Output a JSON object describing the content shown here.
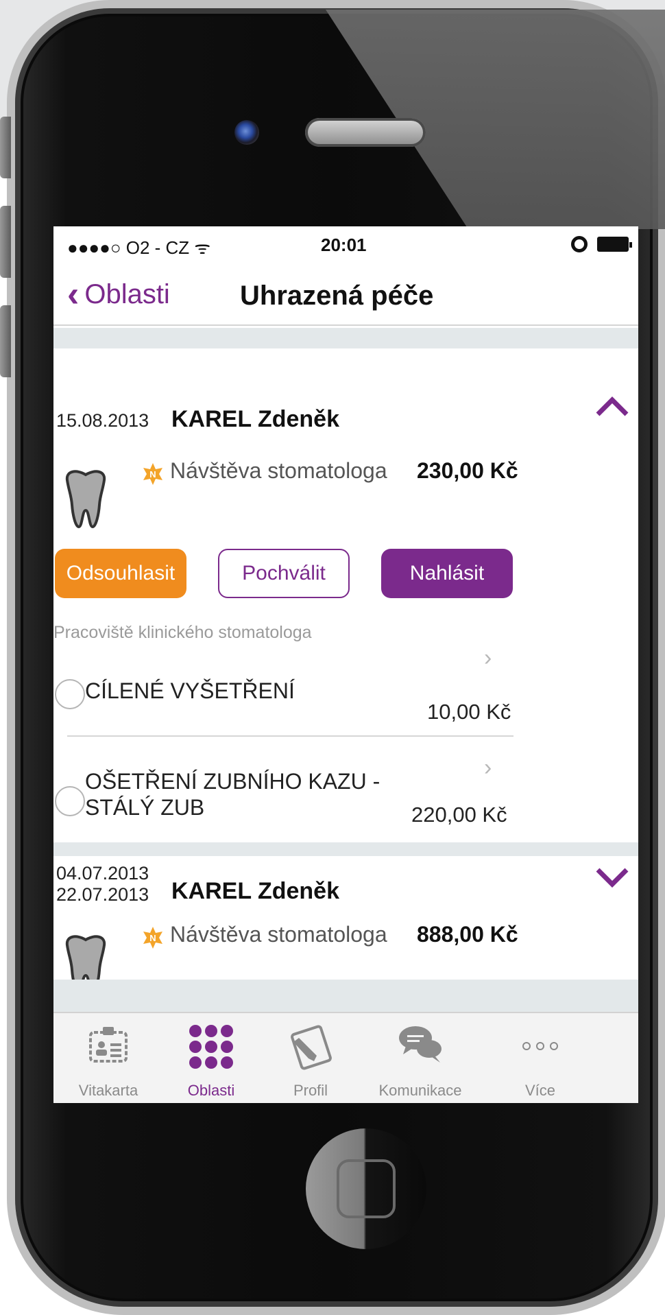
{
  "status_bar": {
    "carrier": "●●●●○ O2 - CZ ᯤ",
    "time": "20:01"
  },
  "nav": {
    "back_label": "Oblasti",
    "title": "Uhrazená péče"
  },
  "cards": [
    {
      "date": "15.08.2013",
      "name": "KAREL Zdeněk",
      "visit_type": "Návštěva stomatologa",
      "amount": "230,00 Kč",
      "expanded": true
    },
    {
      "date": "04.07.2013",
      "date_end": "22.07.2013",
      "name": "KAREL Zdeněk",
      "visit_type": "Návštěva stomatologa",
      "amount": "888,00 Kč",
      "expanded": false
    }
  ],
  "actions": {
    "reject": "Odsouhlasit",
    "praise": "Pochválit",
    "report": "Nahlásit"
  },
  "section_label": "Pracoviště klinického stomatologa",
  "items": [
    {
      "name": "CÍLENÉ VYŠETŘENÍ",
      "amount": "10,00 Kč"
    },
    {
      "name_line1": "OŠETŘENÍ ZUBNÍHO KAZU -",
      "name_line2": "STÁLÝ ZUB",
      "amount": "220,00 Kč"
    }
  ],
  "tabs": [
    {
      "label": "Vitakarta",
      "icon": "id-card-icon"
    },
    {
      "label": "Oblasti",
      "icon": "grid-dots-icon",
      "active": true
    },
    {
      "label": "Profil",
      "icon": "pencil-doc-icon"
    },
    {
      "label": "Komunikace",
      "icon": "chat-bubbles-icon"
    },
    {
      "label": "Více",
      "icon": "more-dots-icon"
    }
  ],
  "colors": {
    "accent": "#7b2a8c",
    "orange": "#f08c1e",
    "band": "#e3e8ea"
  }
}
